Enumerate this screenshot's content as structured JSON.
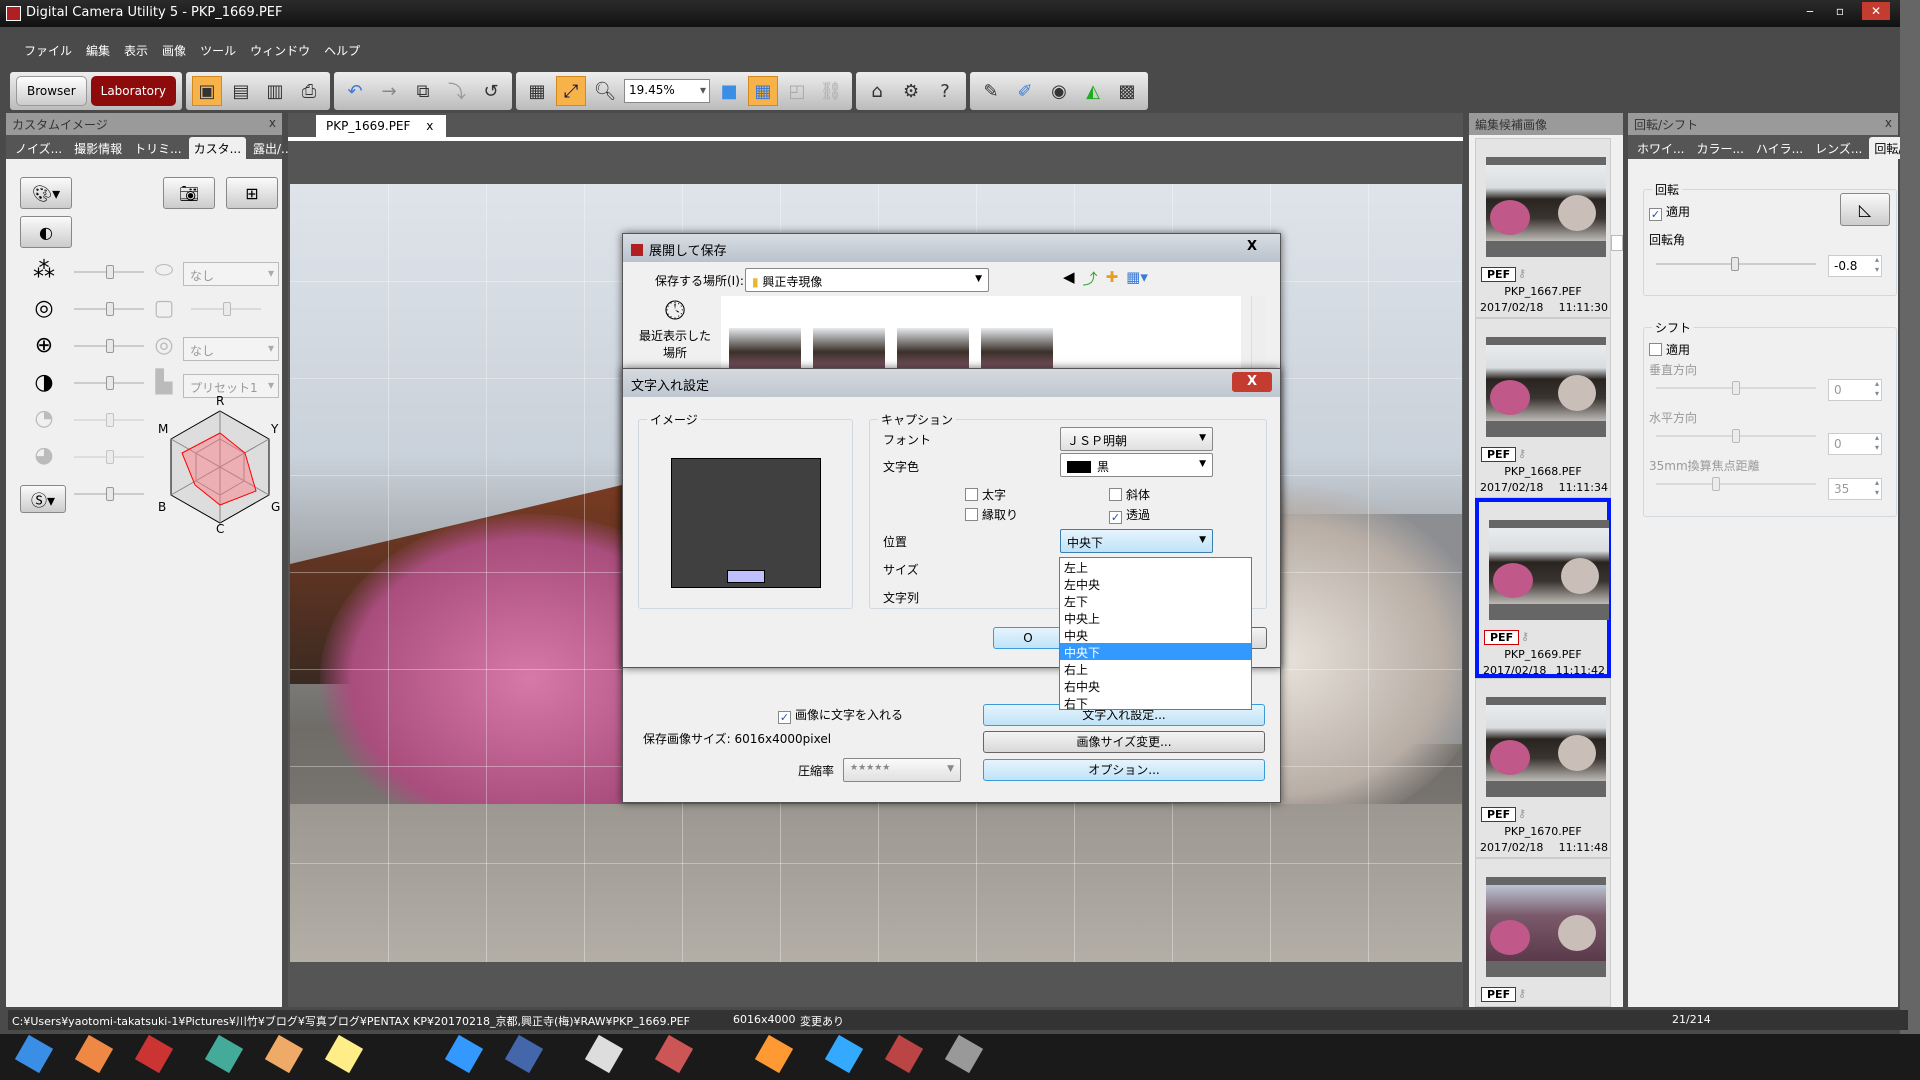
{
  "window": {
    "title": "Digital Camera Utility 5 - PKP_1669.PEF",
    "min": "‒",
    "max": "▫",
    "close": "✕"
  },
  "menu": [
    "ファイル",
    "編集",
    "表示",
    "画像",
    "ツール",
    "ウィンドウ",
    "ヘルプ"
  ],
  "toolbar": {
    "browser": "Browser",
    "laboratory": "Laboratory",
    "zoom": "19.45%"
  },
  "left_panel": {
    "title": "カスタムイメージ",
    "close": "x",
    "tabs": [
      "ノイズ...",
      "撮影情報",
      "トリミ...",
      "カスタ...",
      "露出/..."
    ],
    "active_tab": 3,
    "selects": [
      "なし",
      "なし",
      "プリセット1"
    ],
    "radar_labels": {
      "r": "R",
      "y": "Y",
      "g": "G",
      "c": "C",
      "b": "B",
      "m": "M"
    }
  },
  "doc_tab": {
    "label": "PKP_1669.PEF",
    "close": "x"
  },
  "save_dialog": {
    "title": "展開して保存",
    "close": "X",
    "location_label": "保存する場所(I):",
    "location": "興正寺現像",
    "recent": "最近表示した場所",
    "embed_text_checkbox": "画像に文字を入れる",
    "embed_text_checked": true,
    "size_label": "保存画像サイズ: 6016x4000pixel",
    "compression_label": "圧縮率",
    "compression_value": "★★★★★",
    "text_settings_button": "文字入れ設定...",
    "resize_button": "画像サイズ変更...",
    "options_button": "オプション..."
  },
  "text_dialog": {
    "title": "文字入れ設定",
    "close": "X",
    "image_group": "イメージ",
    "caption_group": "キャプション",
    "font_label": "フォント",
    "font_value": "ＪＳＰ明朝",
    "color_label": "文字色",
    "color_value": "黒",
    "color_swatch": "#000000",
    "bold": "太字",
    "bold_checked": false,
    "italic": "斜体",
    "italic_checked": false,
    "outline": "縁取り",
    "outline_checked": false,
    "transparent": "透過",
    "transparent_checked": true,
    "position_label": "位置",
    "position_value": "中央下",
    "size_label": "サイズ",
    "string_label": "文字列",
    "ok_partial": "O",
    "position_options": [
      "左上",
      "左中央",
      "左下",
      "中央上",
      "中央",
      "中央下",
      "右上",
      "右中央",
      "右下"
    ],
    "position_selected": 5
  },
  "thumbs_panel": {
    "title": "編集候補画像",
    "items": [
      {
        "badge": "PEF",
        "name": "PKP_1667.PEF",
        "date": "2017/02/18",
        "time": "11:11:30"
      },
      {
        "badge": "PEF",
        "name": "PKP_1668.PEF",
        "date": "2017/02/18",
        "time": "11:11:34"
      },
      {
        "badge": "PEF",
        "name": "PKP_1669.PEF",
        "date": "2017/02/18",
        "time": "11:11:42",
        "selected": true
      },
      {
        "badge": "PEF",
        "name": "PKP_1670.PEF",
        "date": "2017/02/18",
        "time": "11:11:48"
      },
      {
        "badge": "PEF"
      }
    ]
  },
  "right_panel": {
    "title": "回転/シフト",
    "close": "x",
    "tabs": [
      "ホワイ...",
      "カラー...",
      "ハイラ...",
      "レンズ...",
      "回転/..."
    ],
    "active_tab": 4,
    "rotation": {
      "group": "回転",
      "apply": "適用",
      "apply_checked": true,
      "angle_label": "回転角",
      "angle_value": "-0.8"
    },
    "shift": {
      "group": "シフト",
      "apply": "適用",
      "apply_checked": false,
      "vertical_label": "垂直方向",
      "vertical_value": "0",
      "horizontal_label": "水平方向",
      "horizontal_value": "0",
      "focal_label": "35mm換算焦点距離",
      "focal_value": "35"
    }
  },
  "status": {
    "path": "C:¥Users¥yaotomi-takatsuki-1¥Pictures¥川竹¥ブログ¥写真ブログ¥PENTAX KP¥20170218_京都,興正寺(梅)¥RAW¥PKP_1669.PEF",
    "dimensions": "6016x4000",
    "modified": "変更あり",
    "count": "21/214"
  }
}
